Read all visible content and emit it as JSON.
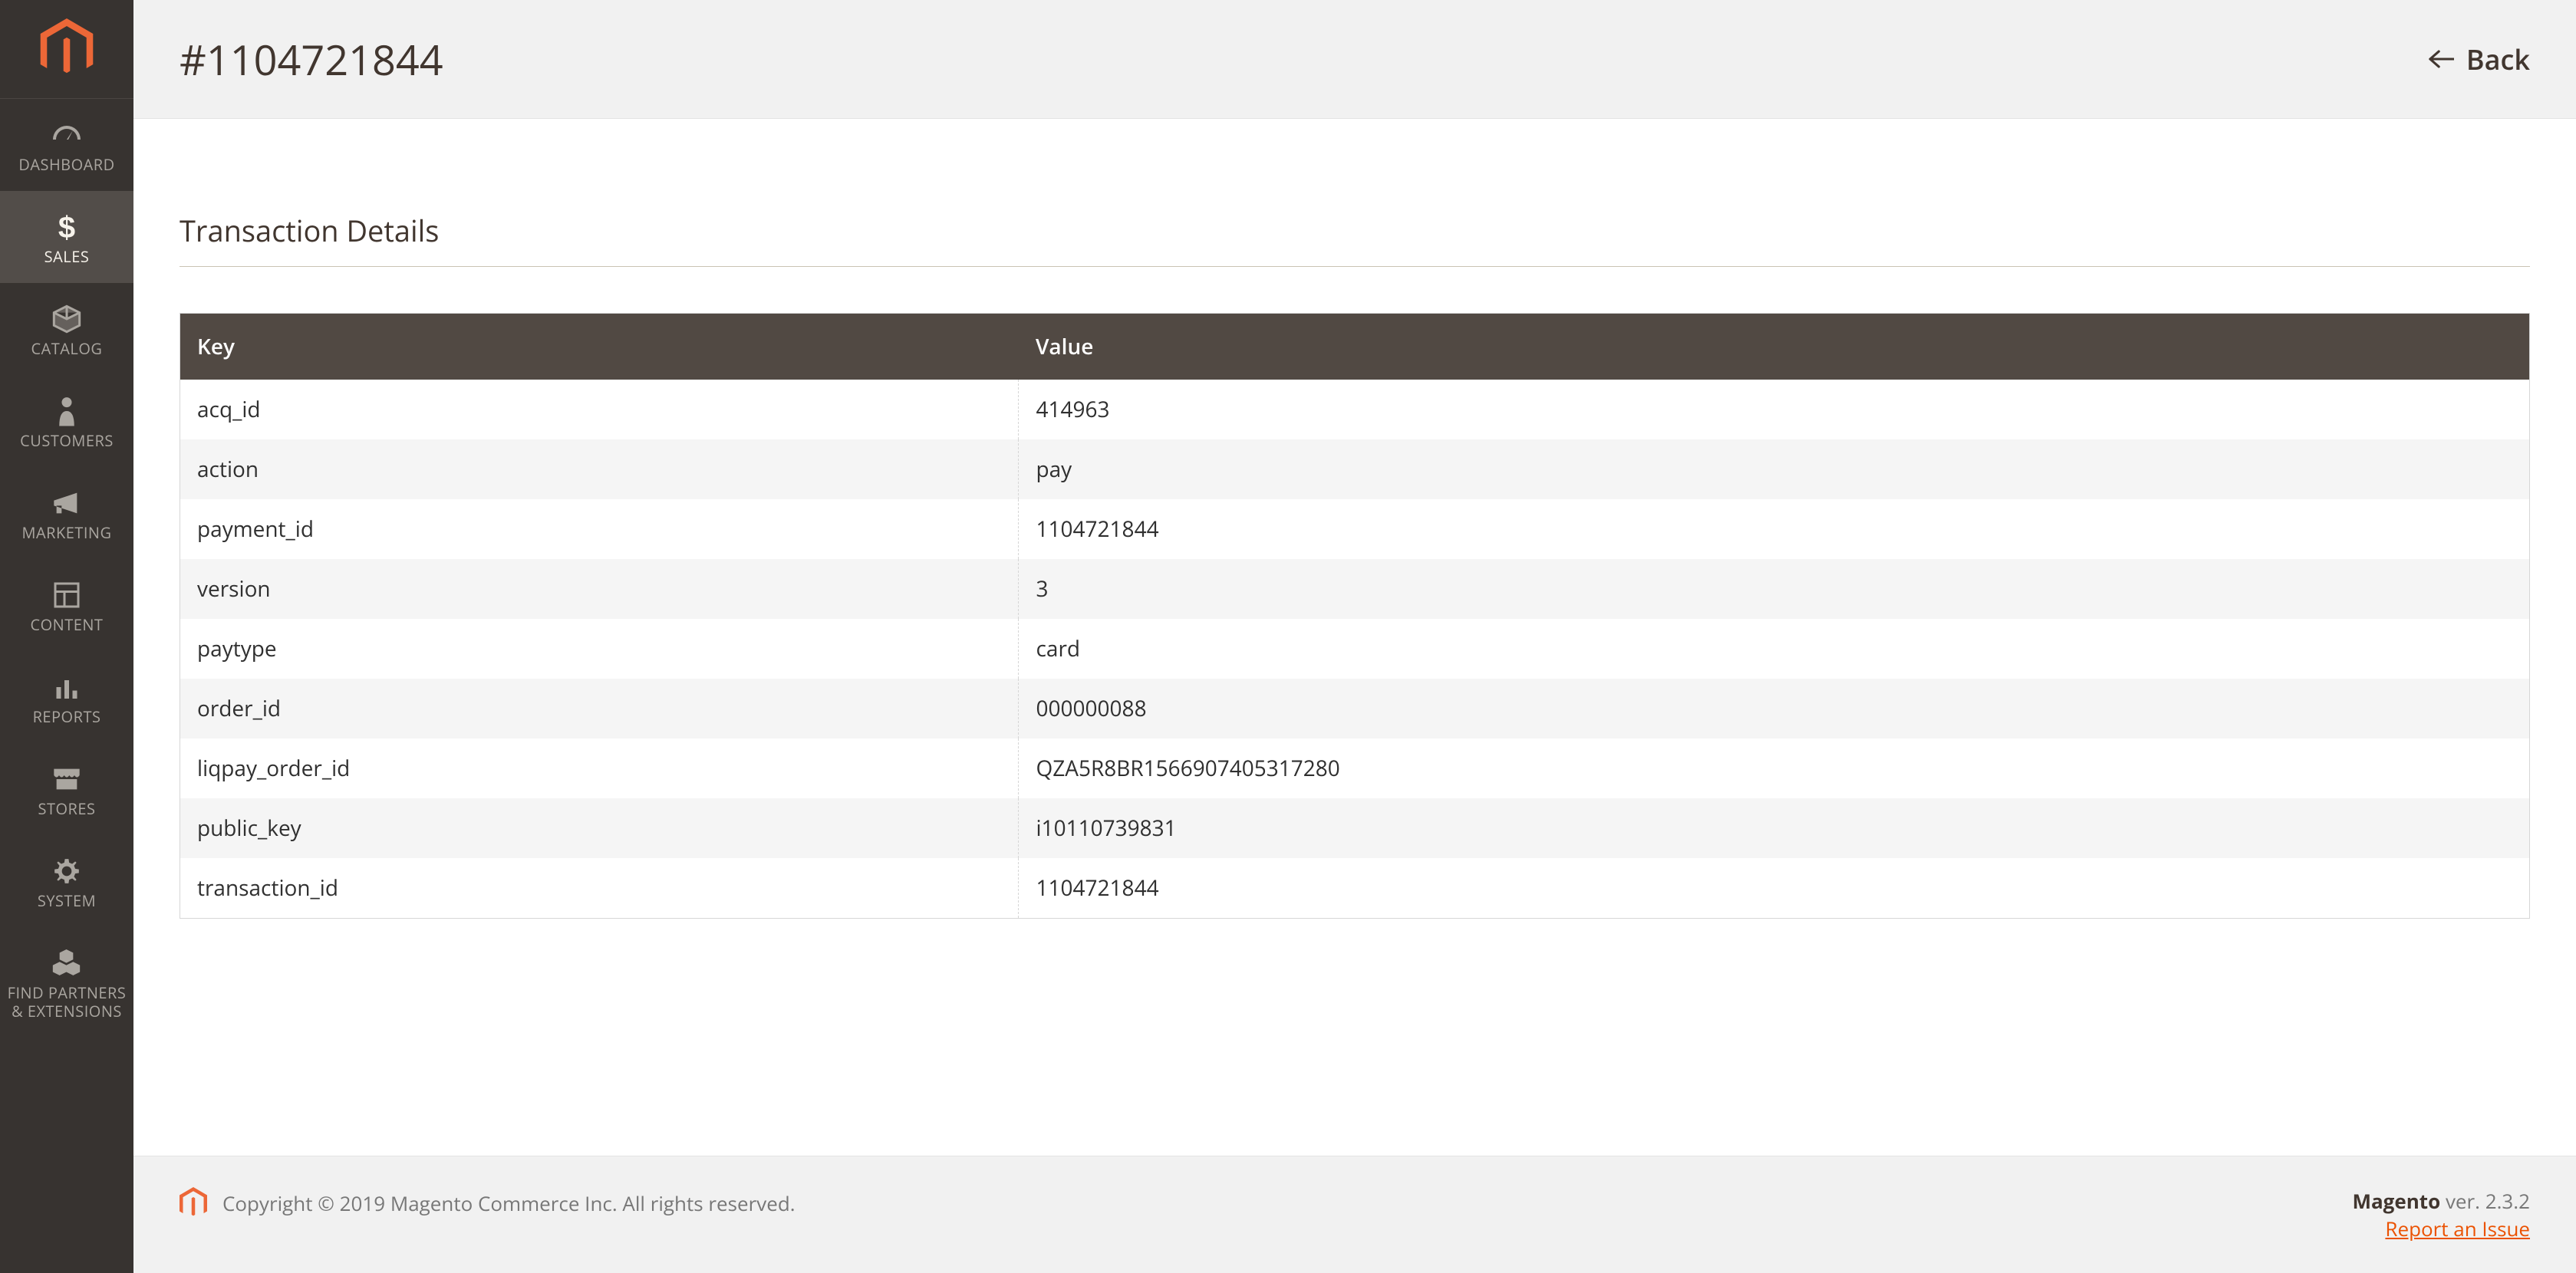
{
  "sidebar": {
    "items": [
      {
        "label": "DASHBOARD",
        "icon": "dashboard"
      },
      {
        "label": "SALES",
        "icon": "dollar",
        "active": true
      },
      {
        "label": "CATALOG",
        "icon": "box"
      },
      {
        "label": "CUSTOMERS",
        "icon": "person"
      },
      {
        "label": "MARKETING",
        "icon": "megaphone"
      },
      {
        "label": "CONTENT",
        "icon": "layout"
      },
      {
        "label": "REPORTS",
        "icon": "bars"
      },
      {
        "label": "STORES",
        "icon": "storefront"
      },
      {
        "label": "SYSTEM",
        "icon": "gear"
      },
      {
        "label": "FIND PARTNERS\n& EXTENSIONS",
        "icon": "boxes"
      }
    ]
  },
  "header": {
    "title": "#1104721844",
    "back_label": "Back"
  },
  "section_title": "Transaction Details",
  "table": {
    "col_key": "Key",
    "col_value": "Value",
    "rows": [
      {
        "key": "acq_id",
        "value": "414963"
      },
      {
        "key": "action",
        "value": "pay"
      },
      {
        "key": "payment_id",
        "value": "1104721844"
      },
      {
        "key": "version",
        "value": "3"
      },
      {
        "key": "paytype",
        "value": "card"
      },
      {
        "key": "order_id",
        "value": "000000088"
      },
      {
        "key": "liqpay_order_id",
        "value": "QZA5R8BR1566907405317280"
      },
      {
        "key": "public_key",
        "value": "i10110739831"
      },
      {
        "key": "transaction_id",
        "value": "1104721844"
      }
    ]
  },
  "footer": {
    "copyright": "Copyright © 2019 Magento Commerce Inc. All rights reserved.",
    "product": "Magento",
    "version": " ver. 2.3.2",
    "report_link": "Report an Issue"
  }
}
